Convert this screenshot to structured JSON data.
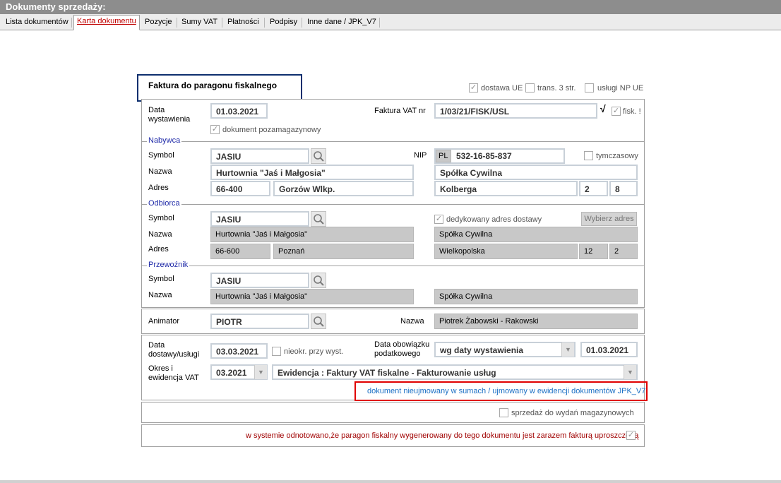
{
  "window": {
    "title": "Dokumenty sprzedaży:"
  },
  "tabs": [
    {
      "label": "Lista dokumentów"
    },
    {
      "label": "Karta dokumentu"
    },
    {
      "label": "Pozycje"
    },
    {
      "label": "Sumy VAT"
    },
    {
      "label": "Płatności"
    },
    {
      "label": "Podpisy"
    },
    {
      "label": "Inne dane / JPK_V7"
    }
  ],
  "header": {
    "doc_type": "Faktura do paragonu fiskalnego",
    "dostawa_ue": "dostawa UE",
    "trans3": "trans. 3 str.",
    "uslugi_np": "usługi NP UE"
  },
  "issue": {
    "date_label": "Data\nwystawienia",
    "date_value": "01.03.2021",
    "nonstock_label": "dokument pozamagazynowy",
    "invoice_nr_label": "Faktura VAT nr",
    "invoice_nr": "1/03/21/FISK/USL",
    "fisk_label": "fisk. !",
    "checkmark": "√"
  },
  "buyer": {
    "section": "Nabywca",
    "symbol_label": "Symbol",
    "symbol": "JASIU",
    "name_label": "Nazwa",
    "name": "Hurtownia \"Jaś i Małgosia\"",
    "address_label": "Adres",
    "postcode": "66-400",
    "city": "Gorzów Wlkp.",
    "nip_label": "NIP",
    "nip_prefix": "PL",
    "nip": "532-16-85-837",
    "temp_label": "tymczasowy",
    "name2": "Spółka Cywilna",
    "street": "Kolberga",
    "house": "2",
    "flat": "8"
  },
  "recipient": {
    "section": "Odbiorca",
    "symbol_label": "Symbol",
    "symbol": "JASIU",
    "name_label": "Nazwa",
    "name": "Hurtownia \"Jaś i Małgosia\"",
    "address_label": "Adres",
    "postcode": "66-600",
    "city": "Poznań",
    "dedicated_label": "dedykowany adres dostawy",
    "choose_button": "Wybierz adres",
    "name2": "Spółka Cywilna",
    "street": "Wielkopolska",
    "house": "12",
    "flat": "2"
  },
  "carrier": {
    "section": "Przewoźnik",
    "symbol_label": "Symbol",
    "symbol": "JASIU",
    "name_label": "Nazwa",
    "name": "Hurtownia \"Jaś i Małgosia\"",
    "name2": "Spółka Cywilna"
  },
  "animator": {
    "label": "Animator",
    "value": "PIOTR",
    "name_label": "Nazwa",
    "name": "Piotrek Żabowski - Rakowski"
  },
  "delivery": {
    "date_label": "Data\ndostawy/usługi",
    "date_value": "03.03.2021",
    "unrecorded_label": "nieokr. przy wyst.",
    "tax_date_label": "Data obowiązku\npodatkowego",
    "tax_mode": "wg daty wystawienia",
    "tax_date": "01.03.2021",
    "period_label": "Okres i\newidencja VAT",
    "period": "03.2021",
    "register": "Ewidencja : Faktury VAT fiskalne - Fakturowanie usług",
    "info_link": "dokument nieujmowany w sumach / ujmowany w ewidencji dokumentów JPK_V7"
  },
  "warehouse": {
    "label": "sprzedaż do wydań magazynowych"
  },
  "footer_note": "w systemie odnotowano,że paragon fiskalny wygenerowany do tego dokumentu jest zarazem fakturą uproszczoną",
  "colors": {
    "section_blue": "#1f2aa8",
    "highlight_red": "#e00000",
    "box_navy": "#0e2f6e",
    "link_blue": "#1a6fc4",
    "note_red": "#a00000"
  }
}
